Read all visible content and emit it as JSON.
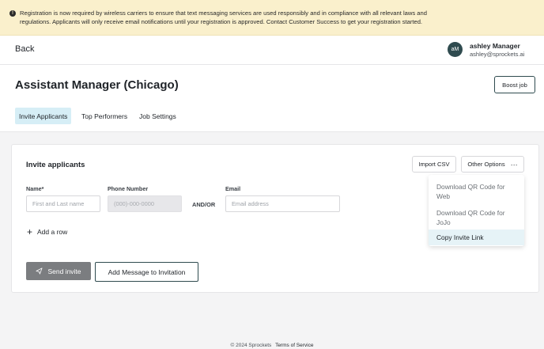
{
  "banner": {
    "icon": "info-icon",
    "text": "Registration is now required by wireless carriers to ensure that text messaging services are used responsibly and in compliance with all relevant laws and regulations. Applicants will only receive email notifications until your registration is approved. Contact Customer Success to get your registration started."
  },
  "topbar": {
    "back_label": "Back",
    "avatar_initials": "aM",
    "user_name": "ashley Manager",
    "user_email": "ashley@sprockets.ai"
  },
  "header": {
    "title": "Assistant Manager (Chicago)",
    "boost_label": "Boost job",
    "tabs": [
      {
        "label": "Invite Applicants",
        "active": true
      },
      {
        "label": "Top Performers",
        "active": false
      },
      {
        "label": "Job Settings",
        "active": false
      }
    ]
  },
  "card": {
    "title": "Invite applicants",
    "import_label": "Import CSV",
    "other_label": "Other Options",
    "fields": {
      "name_label": "Name*",
      "name_placeholder": "First and Last name",
      "phone_label": "Phone Number",
      "phone_placeholder": "(000)-000-0000",
      "andor": "AND/OR",
      "email_label": "Email",
      "email_placeholder": "Email address"
    },
    "add_row_label": "Add a row",
    "send_label": "Send invite",
    "message_label": "Add Message to Invitation"
  },
  "dropdown": {
    "items": [
      {
        "label": "Download QR Code for Web"
      },
      {
        "label": "Download QR Code for JoJo"
      },
      {
        "label": "Copy Invite Link"
      }
    ]
  },
  "footer": {
    "copyright": "© 2024 Sprockets",
    "tos": "Terms of Service"
  },
  "colors": {
    "banner_bg": "#faf0cc",
    "active_tab_bg": "#d6eef6",
    "brand_dark": "#2f4b4f",
    "send_button_bg": "#7b7d80",
    "dropdown_highlight": "#e6f3f7"
  }
}
